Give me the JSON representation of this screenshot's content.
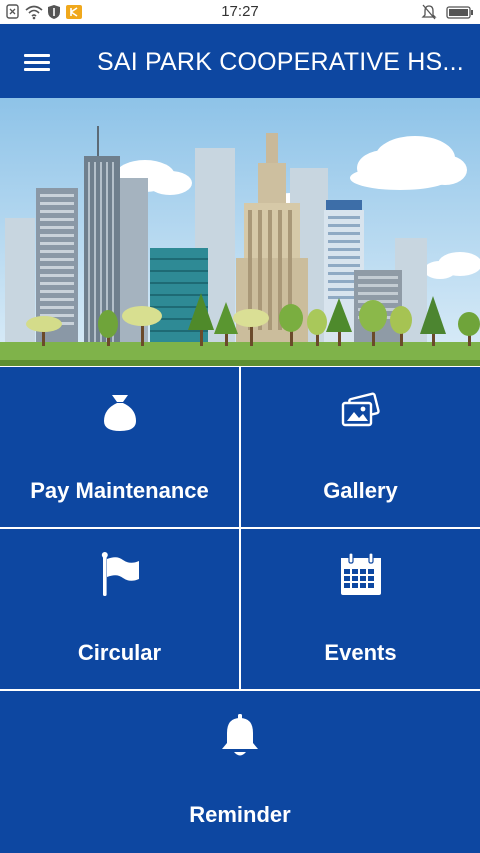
{
  "status_bar": {
    "time": "17:27"
  },
  "app_bar": {
    "title": "SAI PARK COOPERATIVE HS..."
  },
  "menu": [
    {
      "label": "Pay Maintenance",
      "icon": "money-bag-icon"
    },
    {
      "label": "Gallery",
      "icon": "photos-icon"
    },
    {
      "label": "Circular",
      "icon": "flag-icon"
    },
    {
      "label": "Events",
      "icon": "calendar-icon"
    },
    {
      "label": "Reminder",
      "icon": "bell-icon"
    }
  ],
  "colors": {
    "primary": "#0d47a1",
    "divider": "#ffffff"
  }
}
